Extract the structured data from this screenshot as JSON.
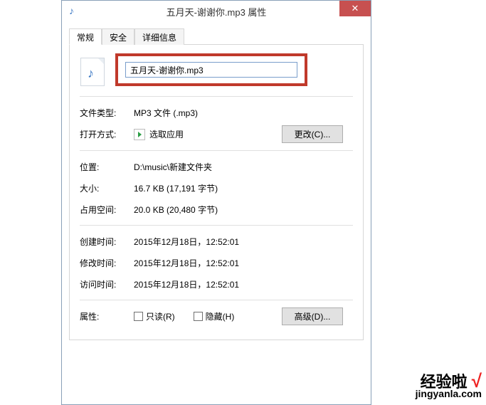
{
  "title": "五月天-谢谢你.mp3 属性",
  "close_glyph": "✕",
  "tabs": {
    "general": "常规",
    "security": "安全",
    "details": "详细信息"
  },
  "filename": "五月天-谢谢你.mp3",
  "labels": {
    "filetype": "文件类型:",
    "opens_with": "打开方式:",
    "location": "位置:",
    "size": "大小:",
    "size_on_disk": "占用空间:",
    "created": "创建时间:",
    "modified": "修改时间:",
    "accessed": "访问时间:",
    "attributes": "属性:"
  },
  "values": {
    "filetype": "MP3 文件 (.mp3)",
    "opens_with": "选取应用",
    "location": "D:\\music\\新建文件夹",
    "size": "16.7 KB (17,191 字节)",
    "size_on_disk": "20.0 KB (20,480 字节)",
    "created": "2015年12月18日，12:52:01",
    "modified": "2015年12月18日，12:52:01",
    "accessed": "2015年12月18日，12:52:01"
  },
  "buttons": {
    "change": "更改(C)...",
    "advanced": "高级(D)..."
  },
  "checkboxes": {
    "readonly": "只读(R)",
    "hidden": "隐藏(H)"
  },
  "icons": {
    "music_note": "♪"
  },
  "watermark": {
    "top": "经验啦",
    "check": "√",
    "bottom": "jingyanla.com"
  }
}
